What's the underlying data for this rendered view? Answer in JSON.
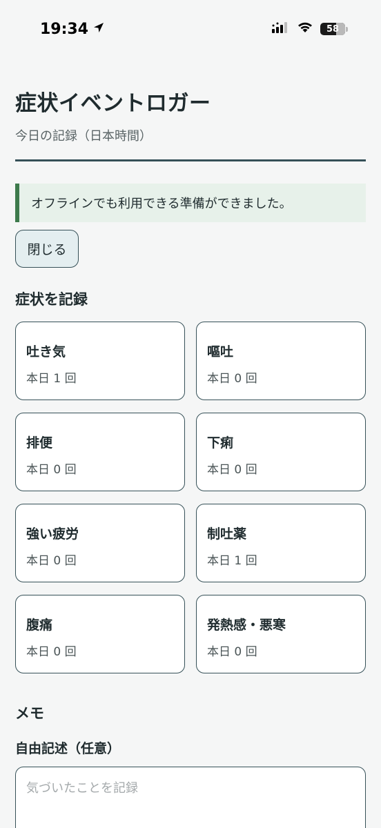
{
  "status_bar": {
    "time": "19:34",
    "battery": "58",
    "icons": [
      "location-arrow-icon",
      "cellular-signal-icon",
      "wifi-icon",
      "battery-icon"
    ]
  },
  "header": {
    "title": "症状イベントロガー",
    "subtitle": "今日の記録（日本時間）"
  },
  "notice": {
    "message": "オフラインでも利用できる準備ができました。",
    "close_label": "閉じる"
  },
  "symptoms": {
    "section_title": "症状を記録",
    "items": [
      {
        "name": "吐き気",
        "count_label": "本日 1 回"
      },
      {
        "name": "嘔吐",
        "count_label": "本日 0 回"
      },
      {
        "name": "排便",
        "count_label": "本日 0 回"
      },
      {
        "name": "下痢",
        "count_label": "本日 0 回"
      },
      {
        "name": "強い疲労",
        "count_label": "本日 0 回"
      },
      {
        "name": "制吐薬",
        "count_label": "本日 1 回"
      },
      {
        "name": "腹痛",
        "count_label": "本日 0 回"
      },
      {
        "name": "発熱感・悪寒",
        "count_label": "本日 0 回"
      }
    ]
  },
  "memo": {
    "section_title": "メモ",
    "label": "自由記述（任意）",
    "placeholder": "気づいたことを記録",
    "value": ""
  },
  "colors": {
    "accent": "#355057",
    "notice_bg": "#e7f1ea",
    "notice_border": "#3d7a4c",
    "background": "#f5f6f6"
  }
}
